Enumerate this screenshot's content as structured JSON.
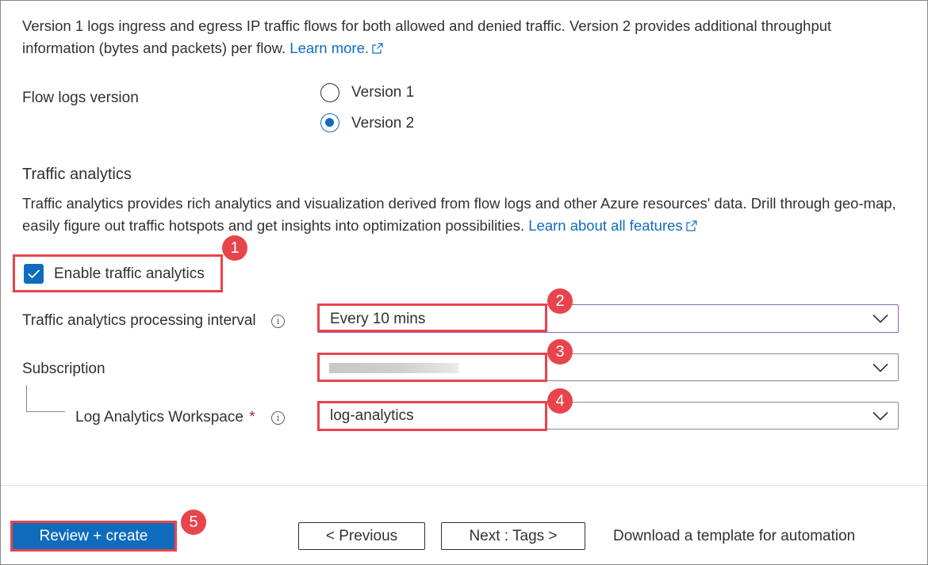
{
  "flow_logs": {
    "description": "Version 1 logs ingress and egress IP traffic flows for both allowed and denied traffic. Version 2 provides additional throughput information (bytes and packets) per flow.",
    "learn_more_link": "Learn more.",
    "version_label": "Flow logs version",
    "options": [
      {
        "label": "Version 1",
        "selected": false
      },
      {
        "label": "Version 2",
        "selected": true
      }
    ]
  },
  "traffic_analytics": {
    "title": "Traffic analytics",
    "description": "Traffic analytics provides rich analytics and visualization derived from flow logs and other Azure resources' data. Drill through geo-map, easily figure out traffic hotspots and get insights into optimization possibilities.",
    "learn_features_link": "Learn about all features",
    "enable_label": "Enable traffic analytics",
    "enable_checked": true,
    "interval_label": "Traffic analytics processing interval",
    "interval_value": "Every 10 mins",
    "subscription_label": "Subscription",
    "subscription_value": "",
    "workspace_label": "Log Analytics Workspace",
    "workspace_required_mark": "*",
    "workspace_value": "log-analytics"
  },
  "callouts": [
    "1",
    "2",
    "3",
    "4",
    "5"
  ],
  "footer": {
    "review_create": "Review + create",
    "previous": "< Previous",
    "next": "Next : Tags >",
    "download_template": "Download a template for automation"
  },
  "colors": {
    "accent": "#0f6cbd",
    "callout": "#e8444c",
    "focus_border": "#8764b8"
  }
}
